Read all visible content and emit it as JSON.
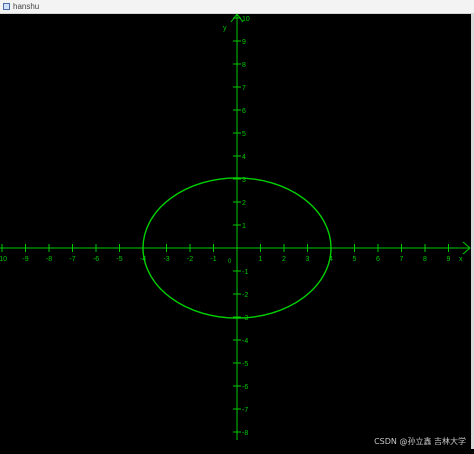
{
  "window": {
    "title": "hanshu",
    "icon": "app-window-icon"
  },
  "plot": {
    "background_color": "#000000",
    "axis_color": "#00c800",
    "curve_color": "#00d000",
    "x_axis_label": "x",
    "y_axis_label": "y",
    "origin_label": "0",
    "x_ticks": [
      "-10",
      "-9",
      "-8",
      "-7",
      "-6",
      "-5",
      "-4",
      "-3",
      "-2",
      "-1",
      "1",
      "2",
      "3",
      "4",
      "5",
      "6",
      "7",
      "8",
      "9"
    ],
    "y_ticks": [
      "10",
      "9",
      "8",
      "7",
      "6",
      "5",
      "4",
      "3",
      "2",
      "1",
      "-1",
      "-2",
      "-3",
      "-4",
      "-5",
      "-6",
      "-7",
      "-8"
    ]
  },
  "chart_data": {
    "type": "line",
    "series": [
      {
        "shape": "ellipse",
        "center": [
          0,
          0
        ],
        "semi_axis_x": 4,
        "semi_axis_y": 3
      }
    ],
    "xlim": [
      -10,
      10
    ],
    "ylim": [
      -8,
      10
    ],
    "grid": false
  },
  "watermark": "CSDN @孙立鑫 吉林大学"
}
